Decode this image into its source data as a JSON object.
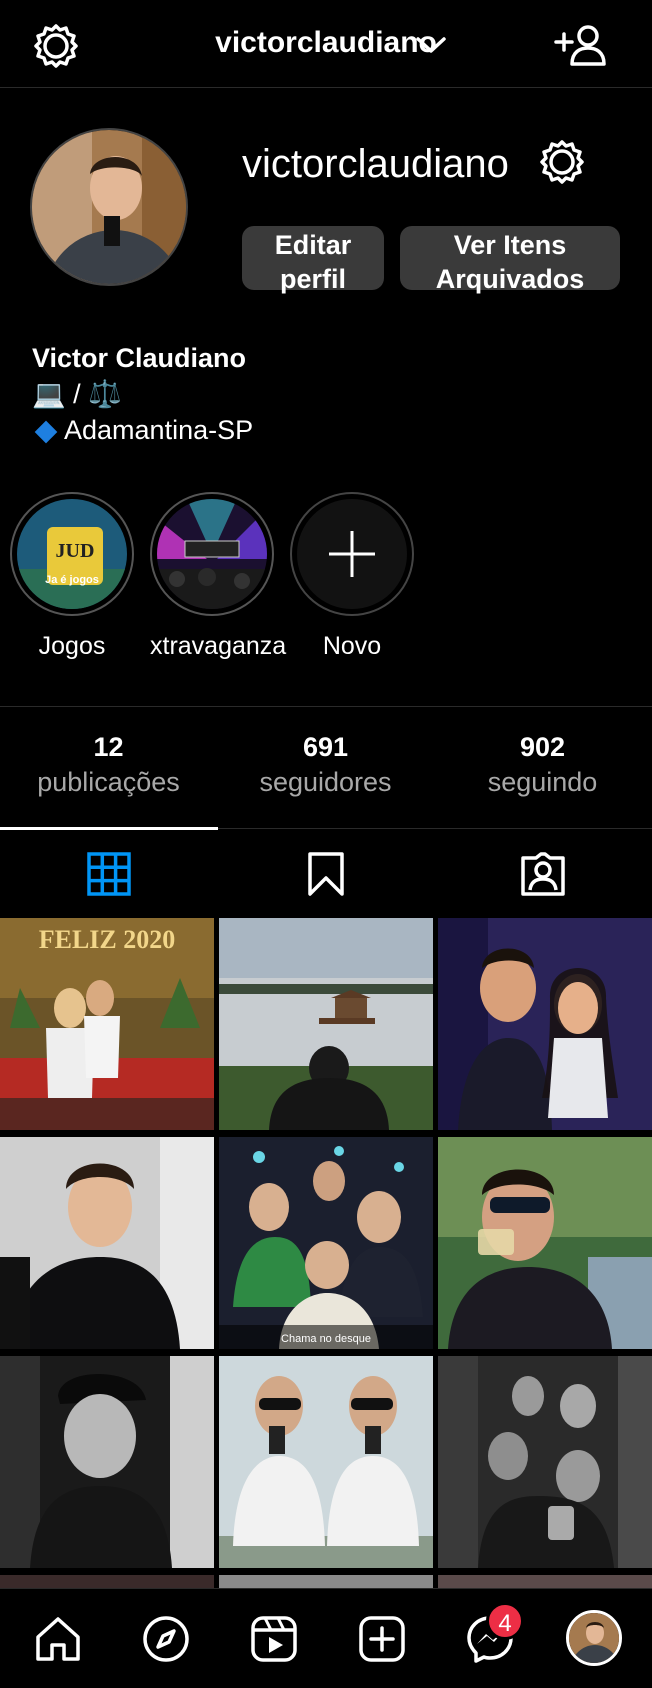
{
  "topbar": {
    "username": "victorclaudiano",
    "icons": [
      "settings-gear-icon",
      "chevron-down-icon",
      "add-user-icon"
    ]
  },
  "profile": {
    "username": "victorclaudiano",
    "edit_label": "Editar perfil",
    "archive_label": "Ver Itens Arquivados",
    "full_name": "Victor Claudiano",
    "bio_line1": "💻 / ⚖️",
    "bio_line2": "Adamantina-SP"
  },
  "highlights": [
    {
      "label": "Jogos",
      "thumb_text": "Ja é jogos"
    },
    {
      "label": "xtravaganza"
    },
    {
      "label": "Novo"
    }
  ],
  "stats": [
    {
      "value": "12",
      "label": "publicações"
    },
    {
      "value": "691",
      "label": "seguidores"
    },
    {
      "value": "902",
      "label": "seguindo"
    }
  ],
  "tabs": [
    "grid-icon",
    "saved-bookmark-icon",
    "tagged-icon"
  ],
  "grid": {
    "posts": [
      {
        "caption": "FELIZ 2020"
      },
      {
        "caption": ""
      },
      {
        "caption": ""
      },
      {
        "caption": ""
      },
      {
        "caption": "Chama no desque"
      },
      {
        "caption": ""
      },
      {
        "caption": ""
      },
      {
        "caption": ""
      },
      {
        "caption": ""
      }
    ]
  },
  "bottom_nav": {
    "items": [
      "home-icon",
      "explore-icon",
      "reels-icon",
      "create-icon",
      "messenger-icon",
      "profile-avatar"
    ],
    "messenger_badge": "4"
  },
  "colors": {
    "background": "#000000",
    "accent_blue": "#0095f6",
    "button_bg": "#3a3a3a",
    "badge_red": "#ed2e45"
  }
}
